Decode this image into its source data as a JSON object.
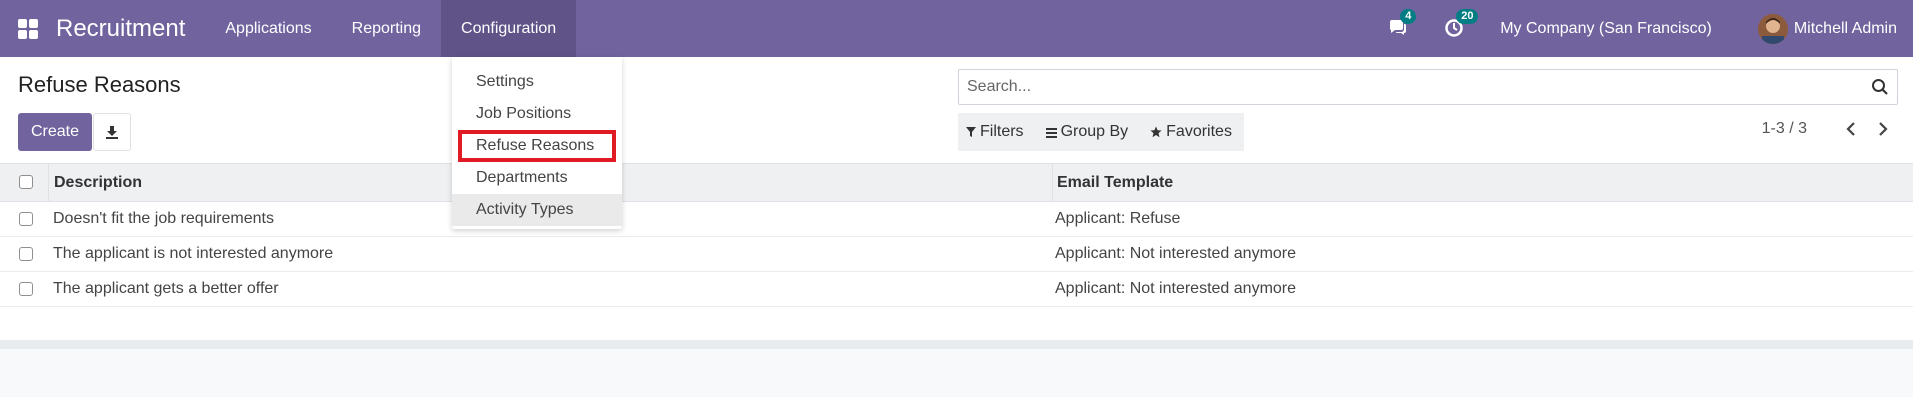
{
  "navbar": {
    "brand": "Recruitment",
    "menu": [
      "Applications",
      "Reporting",
      "Configuration"
    ],
    "messages_badge": "4",
    "activities_badge": "20",
    "company": "My Company (San Francisco)",
    "user": "Mitchell Admin",
    "accent": "#71639e"
  },
  "control_panel": {
    "title": "Refuse Reasons",
    "create_label": "Create",
    "search_placeholder": "Search...",
    "filters_label": "Filters",
    "group_by_label": "Group By",
    "favorites_label": "Favorites",
    "pager": "1-3 / 3"
  },
  "table": {
    "columns": [
      "Description",
      "Email Template"
    ],
    "rows": [
      {
        "description": "Doesn't fit the job requirements",
        "email_template": "Applicant: Refuse"
      },
      {
        "description": "The applicant is not interested anymore",
        "email_template": "Applicant: Not interested anymore"
      },
      {
        "description": "The applicant gets a better offer",
        "email_template": "Applicant: Not interested anymore"
      }
    ]
  },
  "dropdown": {
    "items": [
      "Settings",
      "Job Positions",
      "Refuse Reasons",
      "Departments",
      "Activity Types"
    ],
    "highlight_color": "#e01b24"
  }
}
